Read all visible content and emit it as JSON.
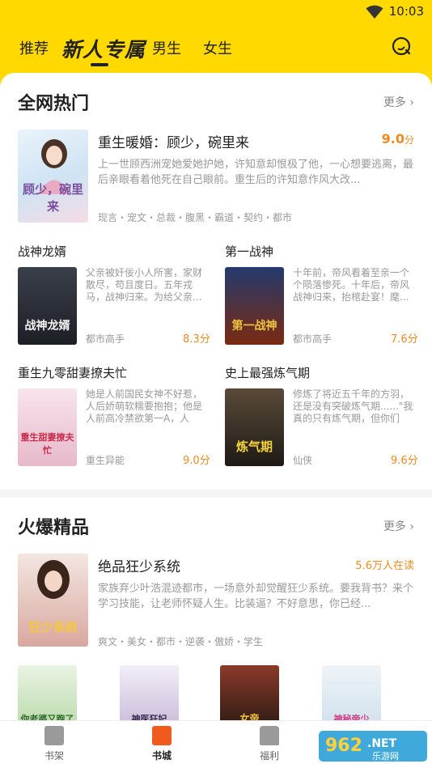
{
  "status": {
    "time": "10:03"
  },
  "top_tabs": [
    {
      "label": "推荐"
    },
    {
      "label": "新人专属"
    },
    {
      "label": "男生"
    },
    {
      "label": "女生"
    }
  ],
  "hot": {
    "title": "全网热门",
    "more": "更多",
    "feature": {
      "title": "重生暖婚：顾少，碗里来",
      "score": "9.0",
      "unit": "分",
      "desc": "上一世顾西洲宠她爱她护她，许知意却恨极了他，一心想要逃离，最后亲眼看着他死在自己眼前。重生后的许知意作风大改...",
      "tags": "现言・宠文・总裁・腹黑・霸道・契约・都市",
      "cover_text": "顾少，碗里来"
    },
    "books": [
      {
        "title": "战神龙婿",
        "desc": "父亲被奸佞小人所害，家财散尽，苟且度日。五年戎马，战神归来。为给父亲...",
        "tag": "都市高手",
        "score": "8.3",
        "unit": "分",
        "cover_text": "战神龙婿"
      },
      {
        "title": "第一战神",
        "desc": "十年前，帝风看着至亲一个个陨落惨死。十年后，帝风战神归来，抬棺赴宴！麾...",
        "tag": "都市高手",
        "score": "7.6",
        "unit": "分",
        "cover_text": "第一战神"
      },
      {
        "title": "重生九零甜妻撩夫忙",
        "desc": "她是人前国民女神不好惹，人后娇萌软糯要抱抱；他是人前高冷禁欲第一A，人后...",
        "tag": "重生异能",
        "score": "9.0",
        "unit": "分",
        "cover_text": "重生甜妻撩夫忙"
      },
      {
        "title": "史上最强炼气期",
        "desc": "修炼了将近五千年的方羽，还是没有突破炼气期......\"我真的只有炼气期，但你们别...",
        "tag": "仙侠",
        "score": "9.6",
        "unit": "分",
        "cover_text": "炼气期"
      }
    ]
  },
  "premium": {
    "title": "火爆精品",
    "more": "更多",
    "feature": {
      "title": "绝品狂少系统",
      "readers": "5.6万人在读",
      "desc": "家族弃少叶浩混迹都市，一场意外却觉醒狂少系统。要我背书？来个学习技能，让老师怀疑人生。比装逼？不好意思，你已经...",
      "tags": "爽文・美女・都市・逆袭・傲娇・学生",
      "cover_text": "狂少系统"
    },
    "covers": [
      "你老婆又跑了",
      "神医狂妃",
      "女帝",
      "神秘帝少"
    ]
  },
  "bottom_nav": [
    {
      "label": "书架"
    },
    {
      "label": "书城"
    },
    {
      "label": "福利"
    }
  ],
  "watermark": {
    "brand": "962",
    "net": ".NET",
    "sub": "乐游网"
  },
  "colors": {
    "accent": "#ffd900",
    "score": "#f08a1e",
    "active_tab": "#f05a1e"
  }
}
